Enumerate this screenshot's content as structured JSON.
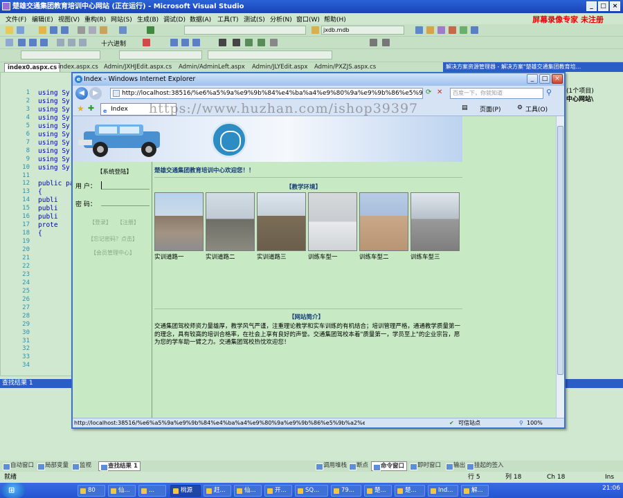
{
  "vs": {
    "title": "楚雄交通集团教育培训中心网站 (正在运行) - Microsoft Visual Studio",
    "watermark_brand": "屏幕录像专家  未注册",
    "menu": [
      "文件(F)",
      "编辑(E)",
      "视图(V)",
      "重构(R)",
      "网站(S)",
      "生成(B)",
      "调试(D)",
      "数据(A)",
      "工具(T)",
      "测试(S)",
      "分析(N)",
      "窗口(W)",
      "帮助(H)"
    ],
    "toolbar_db": "jxdb.mdb",
    "toolbar_hex": "十六进制",
    "doc_tabs": [
      "index0.aspx.cs",
      "index.aspx.cs",
      "Admin/JXHJEdit.aspx.cs",
      "Admin/AdminLeft.aspx",
      "Admin/JLYEdit.aspx",
      "Admin/PXZJS.aspx.cs"
    ],
    "solution_title": "解决方案资源管理器 - 解决方案\"楚雄交通集团教育培...",
    "solution_line1": "(1个项目)",
    "solution_line2": "中心网站\\",
    "line_numbers": [
      "1",
      "2",
      "3",
      "4",
      "5",
      "6",
      "7",
      "8",
      "9",
      "10",
      "11",
      "12",
      "13",
      "14",
      "15",
      "16",
      "17",
      "18",
      "19",
      "20",
      "21",
      "22",
      "23",
      "24",
      "25",
      "26",
      "27",
      "28",
      "29",
      "30",
      "31",
      "32",
      "33",
      "34"
    ],
    "code_lines": [
      "using Sy",
      "using Sy",
      "using Sy",
      "using Sy",
      "using Sy",
      "using Sy",
      "using Sy",
      "using Sy",
      "using Sy",
      "using Sy",
      "",
      "public pa",
      "{",
      "    publi",
      "    publi",
      "    publi",
      "    prote",
      "    {"
    ],
    "find_title": "查找结果 1",
    "bottom_tabs_left": [
      "自动窗口",
      "局部变量",
      "监视",
      "查找结果 1"
    ],
    "bottom_tabs_right": [
      "调用堆栈",
      "断点",
      "命令窗口",
      "即时窗口",
      "输出",
      "挂起的签入"
    ],
    "status": {
      "ready": "就绪",
      "row": "行 5",
      "col": "列 18",
      "ch": "Ch 18",
      "ins": "Ins"
    },
    "taskbar": [
      "80",
      "仙...",
      "...",
      "桃源",
      "赶...",
      "仙...",
      "开...",
      "SQ...",
      "79...",
      "楚...",
      "楚...",
      "Ind...",
      "解..."
    ],
    "clock": "21:06"
  },
  "ie": {
    "title": "Index - Windows Internet Explorer",
    "url": "http://localhost:38516/%e6%a5%9a%e9%9b%84%e4%ba%a4%e9%80%9a%e9%9b%86%e5%9b%a2",
    "search_placeholder": "百度一下，你就知道",
    "tab_label": "Index",
    "page_menu": "页面(P)",
    "tools_menu": "工具(O)",
    "status_url": "http://localhost:38516/%e6%a5%9a%e9%9b%84%e4%ba%a4%e9%80%9a%e9%9b%86%e5%9b%a2%e6%95%99%e8%82%b2%",
    "zone": "可信站点",
    "zoom": "100%",
    "watermark_url": "https://www.huzhan.com/ishop39397"
  },
  "web": {
    "sys_login": "【系统登陆】",
    "user_label": "用  户：",
    "pwd_label": "密  码：",
    "login_link": "【登录】",
    "register_link": "【注册】",
    "forgot_link": "【忘记密码？点击】",
    "admin_link": "【会员管理中心】",
    "welcome": "楚雄交通集团教育培训中心欢迎您！！",
    "env_title": "【教学环境】",
    "photos": [
      "实训道路一",
      "实训道路二",
      "实训道路三",
      "训练车型一",
      "训练车型二",
      "训练车型三"
    ],
    "intro_title": "【网站简介】",
    "intro_text": "交通集团驾校师资力量雄厚，教学风气严谨，注重理论教学和实车训练的有机结合；培训管理严格，通通教学质量第一的理念，具有较高的培训合格率，在社会上享有良好的声誉。交通集团驾校本着\"质量第一，学员至上\"的企业宗旨，愿为您的学车助一臂之力。交通集团驾校热忱欢迎您！"
  },
  "colors": {
    "vs_title": "#1844b7",
    "panel_green": "#cfe8cf",
    "ie_border": "#3b6fd0",
    "welcome_blue": "#163c7a",
    "watermark_red": "#ee0000"
  }
}
